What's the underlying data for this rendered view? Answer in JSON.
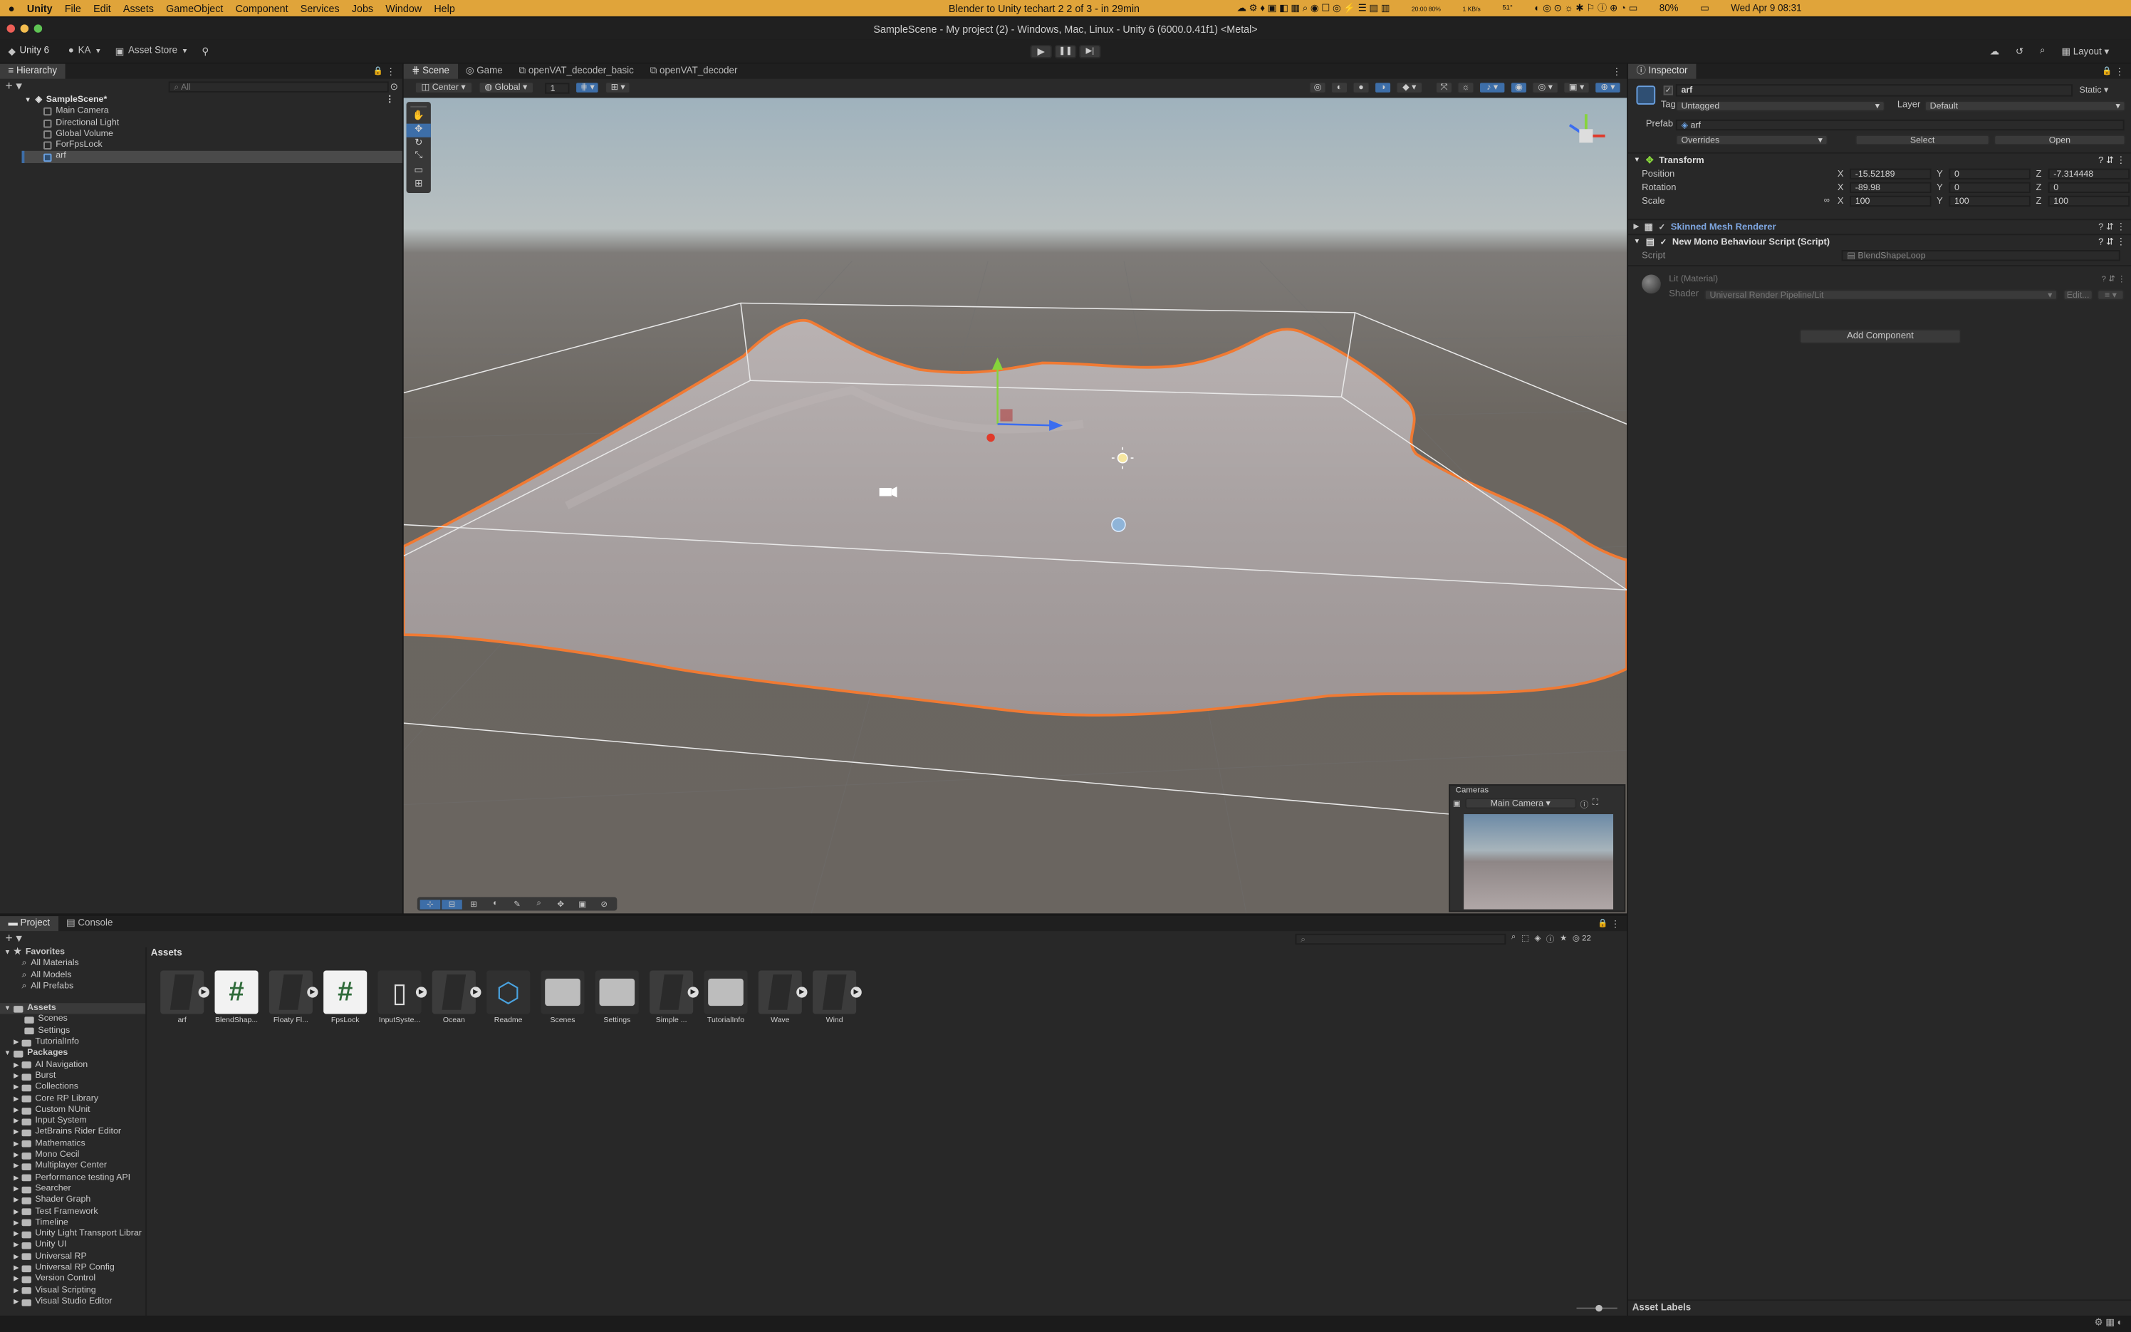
{
  "menubar": {
    "app": "Unity",
    "items": [
      "File",
      "Edit",
      "Assets",
      "GameObject",
      "Component",
      "Services",
      "Jobs",
      "Window",
      "Help"
    ],
    "notice": "Blender to Unity techart 2 2 of 3 - in 29min",
    "battery": "80%",
    "clock": "Wed Apr 9  08:31",
    "net1": "1 KB/s",
    "net2": "1 KB/s",
    "temp": "51°",
    "stat": "20:00 80%"
  },
  "titlebar": {
    "title": "SampleScene - My project (2) - Windows, Mac, Linux - Unity 6 (6000.0.41f1) <Metal>"
  },
  "toolbar": {
    "unity": "Unity 6",
    "account": "KA",
    "store": "Asset Store",
    "layout": "Layout"
  },
  "hierarchy": {
    "tab": "Hierarchy",
    "search_placeholder": "All",
    "scene": "SampleScene*",
    "items": [
      "Main Camera",
      "Directional Light",
      "Global Volume",
      "ForFpsLock",
      "arf"
    ]
  },
  "scene": {
    "tabs": [
      "Scene",
      "Game",
      "openVAT_decoder_basic",
      "openVAT_decoder"
    ],
    "pivot": "Center",
    "space": "Global",
    "snap": "1"
  },
  "cameras": {
    "title": "Cameras",
    "camera": "Main Camera"
  },
  "inspector": {
    "tab": "Inspector",
    "name": "arf",
    "static": "Static",
    "tag_label": "Tag",
    "tag": "Untagged",
    "layer_label": "Layer",
    "layer": "Default",
    "prefab_label": "Prefab",
    "prefab": "arf",
    "overrides": "Overrides",
    "select": "Select",
    "open": "Open",
    "transform": "Transform",
    "position": {
      "label": "Position",
      "x": "-15.52189",
      "y": "0",
      "z": "-7.314448"
    },
    "rotation": {
      "label": "Rotation",
      "x": "-89.98",
      "y": "0",
      "z": "0"
    },
    "scale": {
      "label": "Scale",
      "x": "100",
      "y": "100",
      "z": "100"
    },
    "smr": "Skinned Mesh Renderer",
    "mono": "New Mono Behaviour Script (Script)",
    "script_label": "Script",
    "script": "BlendShapeLoop",
    "material": "Lit (Material)",
    "shader_label": "Shader",
    "shader": "Universal Render Pipeline/Lit",
    "edit": "Edit...",
    "add": "Add Component",
    "asset_labels": "Asset Labels"
  },
  "bottom": {
    "tabs": [
      "Project",
      "Console"
    ],
    "count": "22",
    "breadcrumb": "Assets",
    "favorites": {
      "title": "Favorites",
      "items": [
        "All Materials",
        "All Models",
        "All Prefabs"
      ]
    },
    "assets_root": "Assets",
    "assets_sub": [
      "Scenes",
      "Settings",
      "TutorialInfo"
    ],
    "packages_root": "Packages",
    "packages": [
      "AI Navigation",
      "Burst",
      "Collections",
      "Core RP Library",
      "Custom NUnit",
      "Input System",
      "JetBrains Rider Editor",
      "Mathematics",
      "Mono Cecil",
      "Multiplayer Center",
      "Performance testing API",
      "Searcher",
      "Shader Graph",
      "Test Framework",
      "Timeline",
      "Unity Light Transport Librar",
      "Unity UI",
      "Universal RP",
      "Universal RP Config",
      "Version Control",
      "Visual Scripting",
      "Visual Studio Editor"
    ],
    "assets": [
      "arf",
      "BlendShap...",
      "Floaty Fl...",
      "FpsLock",
      "InputSyste...",
      "Ocean",
      "Readme",
      "Scenes",
      "Settings",
      "Simple ...",
      "TutorialInfo",
      "Wave",
      "Wind"
    ]
  },
  "colors": {
    "accent": "#3d6ea8",
    "selection": "#f07a33",
    "menubar": "#e0a43a"
  }
}
